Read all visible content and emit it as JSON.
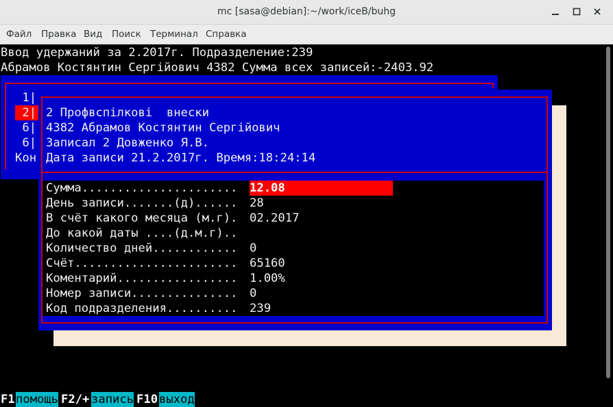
{
  "window": {
    "title": "mc [sasa@debian]:~/work/iceB/buhg",
    "menu": [
      "Файл",
      "Правка",
      "Вид",
      "Поиск",
      "Терминал",
      "Справка"
    ]
  },
  "header": {
    "line1": "Ввод удержаний за 2.2017г. Подразделение:239",
    "line2": "Абрамов Костянтин Сергійович 4382 Сумма всех записей:-2403.92"
  },
  "list": {
    "rows": [
      " 1|",
      " 2|",
      " 6|",
      " 6|",
      "Кон"
    ]
  },
  "dialog": {
    "info": [
      "2 Профвспілкові  внески",
      "4382 Абрамов Костянтин Сергійович",
      "Записал 2 Довженко Я.В.",
      "Дата записи 21.2.2017г. Время:18:24:14"
    ],
    "fields": [
      {
        "label": "Сумма......................",
        "value": "12.08"
      },
      {
        "label": "День записи.......(д)......",
        "value": "28"
      },
      {
        "label": "В счёт какого месяца (м.г).",
        "value": "02.2017"
      },
      {
        "label": "До какой даты ....(д.м.г)..",
        "value": ""
      },
      {
        "label": "Количество дней............",
        "value": "0"
      },
      {
        "label": "Счёт.......................",
        "value": "65160"
      },
      {
        "label": "Коментарий.................",
        "value": "1.00%"
      },
      {
        "label": "Номер записи...............",
        "value": "0"
      },
      {
        "label": "Код подразделения..........",
        "value": "239"
      }
    ]
  },
  "footer": {
    "keys": [
      {
        "key": "F1",
        "label": "помощь"
      },
      {
        "key": "F2/+",
        "label": "запись"
      },
      {
        "key": "F10",
        "label": "выход"
      }
    ]
  },
  "colors": {
    "dialog_bg": "#0000cc",
    "frame": "#cc0000",
    "highlight": "#ff0000",
    "fkey_label": "#00b8c8"
  }
}
